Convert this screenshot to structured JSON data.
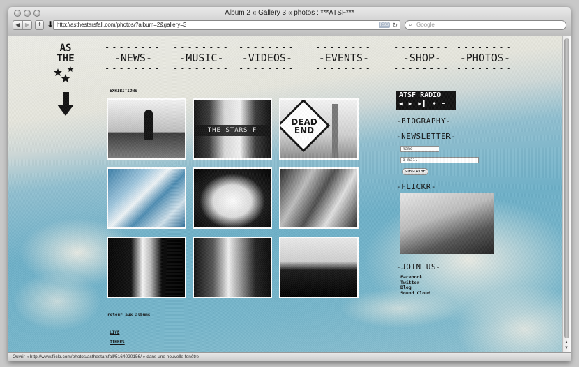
{
  "window": {
    "title": "Album 2 « Gallery 3 « photos : ***ATSF***",
    "url": "http://asthestarsfall.com/photos/?album=2&gallery=3",
    "rss_badge": "RSS",
    "search_placeholder": "Google",
    "status_text": "Ouvrir « http://www.flickr.com/photos/asthestarsfall/5164020156/ » dans une nouvelle fenêtre"
  },
  "logo": {
    "line1": "AS",
    "line2": "THE",
    "stars": "★ ★\n ★"
  },
  "nav": {
    "dashes": "--------",
    "items": [
      {
        "label": "-NEWS-"
      },
      {
        "label": "-MUSIC-"
      },
      {
        "label": "-VIDEOS-"
      },
      {
        "label": "-EVENTS-"
      },
      {
        "label": "-SHOP-"
      },
      {
        "label": "-PHOTOS-"
      }
    ]
  },
  "gallery": {
    "section_link": "EXHIBITIONS",
    "back_link": "retour aux albums",
    "thumb_caption_2": "THE STARS F",
    "thumb_sign_3": "DEAD END",
    "extra_links": [
      "LIVE",
      "OTHERS"
    ]
  },
  "sidebar": {
    "radio_title": "ATSF RADIO",
    "radio_controls": "◀ ▶ ▶▌ + −",
    "biography": "-BIOGRAPHY-",
    "newsletter": "-NEWSLETTER-",
    "name_placeholder": "name",
    "email_placeholder": "e-mail",
    "subscribe_label": "SUBSCRIBE",
    "flickr": "-FLICKR-",
    "join_us": "-JOIN US-",
    "join_links": [
      "Facebook",
      "Twitter",
      "Blog",
      "Sound Cloud"
    ]
  }
}
